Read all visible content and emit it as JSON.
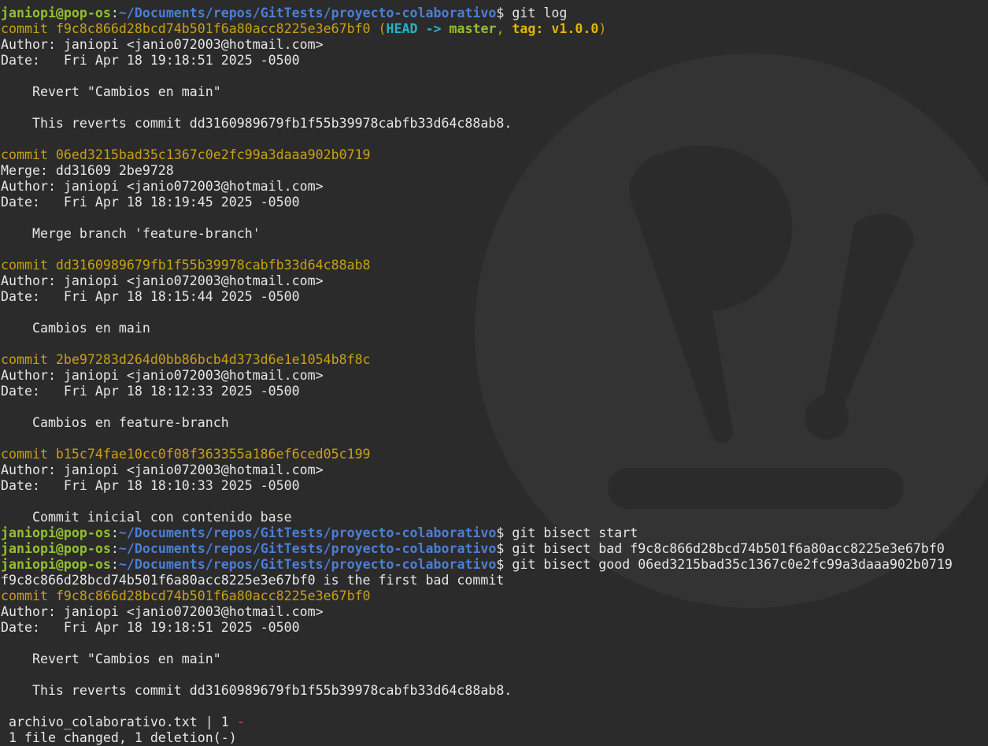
{
  "prompt": {
    "user": "janiopi@pop-os",
    "sep": ":",
    "path": "~/Documents/repos/GitTests/proyecto-colaborativo",
    "symbol": "$ "
  },
  "lines": [
    {
      "kind": "cut"
    },
    {
      "kind": "prompt",
      "cmd": "git log"
    },
    {
      "kind": "commit_ref",
      "prefix": "commit f9c8c866d28bcd74b501f6a80acc8225e3e67bf0 ",
      "open": "(",
      "head": "HEAD -> ",
      "branch": "master",
      "comma": ", ",
      "tag": "tag: v1.0.0",
      "close": ")"
    },
    {
      "kind": "text",
      "text": "Author: janiopi <janio072003@hotmail.com>"
    },
    {
      "kind": "text",
      "text": "Date:   Fri Apr 18 19:18:51 2025 -0500"
    },
    {
      "kind": "text",
      "text": ""
    },
    {
      "kind": "text",
      "text": "    Revert \"Cambios en main\""
    },
    {
      "kind": "text",
      "text": ""
    },
    {
      "kind": "text",
      "text": "    This reverts commit dd3160989679fb1f55b39978cabfb33d64c88ab8."
    },
    {
      "kind": "text",
      "text": ""
    },
    {
      "kind": "commit",
      "text": "commit 06ed3215bad35c1367c0e2fc99a3daaa902b0719"
    },
    {
      "kind": "text",
      "text": "Merge: dd31609 2be9728"
    },
    {
      "kind": "text",
      "text": "Author: janiopi <janio072003@hotmail.com>"
    },
    {
      "kind": "text",
      "text": "Date:   Fri Apr 18 18:19:45 2025 -0500"
    },
    {
      "kind": "text",
      "text": ""
    },
    {
      "kind": "text",
      "text": "    Merge branch 'feature-branch'"
    },
    {
      "kind": "text",
      "text": ""
    },
    {
      "kind": "commit",
      "text": "commit dd3160989679fb1f55b39978cabfb33d64c88ab8"
    },
    {
      "kind": "text",
      "text": "Author: janiopi <janio072003@hotmail.com>"
    },
    {
      "kind": "text",
      "text": "Date:   Fri Apr 18 18:15:44 2025 -0500"
    },
    {
      "kind": "text",
      "text": ""
    },
    {
      "kind": "text",
      "text": "    Cambios en main"
    },
    {
      "kind": "text",
      "text": ""
    },
    {
      "kind": "commit",
      "text": "commit 2be97283d264d0bb86bcb4d373d6e1e1054b8f8c"
    },
    {
      "kind": "text",
      "text": "Author: janiopi <janio072003@hotmail.com>"
    },
    {
      "kind": "text",
      "text": "Date:   Fri Apr 18 18:12:33 2025 -0500"
    },
    {
      "kind": "text",
      "text": ""
    },
    {
      "kind": "text",
      "text": "    Cambios en feature-branch"
    },
    {
      "kind": "text",
      "text": ""
    },
    {
      "kind": "commit",
      "text": "commit b15c74fae10cc0f08f363355a186ef6ced05c199"
    },
    {
      "kind": "text",
      "text": "Author: janiopi <janio072003@hotmail.com>"
    },
    {
      "kind": "text",
      "text": "Date:   Fri Apr 18 18:10:33 2025 -0500"
    },
    {
      "kind": "text",
      "text": ""
    },
    {
      "kind": "text",
      "text": "    Commit inicial con contenido base"
    },
    {
      "kind": "prompt",
      "cmd": "git bisect start"
    },
    {
      "kind": "prompt",
      "cmd": "git bisect bad f9c8c866d28bcd74b501f6a80acc8225e3e67bf0"
    },
    {
      "kind": "prompt",
      "cmd": "git bisect good 06ed3215bad35c1367c0e2fc99a3daaa902b0719"
    },
    {
      "kind": "text",
      "text": "f9c8c866d28bcd74b501f6a80acc8225e3e67bf0 is the first bad commit"
    },
    {
      "kind": "commit",
      "text": "commit f9c8c866d28bcd74b501f6a80acc8225e3e67bf0"
    },
    {
      "kind": "text",
      "text": "Author: janiopi <janio072003@hotmail.com>"
    },
    {
      "kind": "text",
      "text": "Date:   Fri Apr 18 19:18:51 2025 -0500"
    },
    {
      "kind": "text",
      "text": ""
    },
    {
      "kind": "text",
      "text": "    Revert \"Cambios en main\""
    },
    {
      "kind": "text",
      "text": ""
    },
    {
      "kind": "text",
      "text": "    This reverts commit dd3160989679fb1f55b39978cabfb33d64c88ab8."
    },
    {
      "kind": "text",
      "text": ""
    },
    {
      "kind": "stat",
      "text": " archivo_colaborativo.txt | 1 ",
      "minus": "-"
    },
    {
      "kind": "text",
      "text": " 1 file changed, 1 deletion(-)"
    }
  ],
  "colors": {
    "background": "#2b2b2b",
    "text": "#e6e6e6",
    "prompt_user": "#94bf30",
    "prompt_path": "#4a7fd6",
    "commit_hash": "#c8a017",
    "head_ref": "#27b1c6",
    "tag_ref": "#e0b400",
    "deletion": "#e04a3f"
  },
  "background_logo": "pop-os-logo"
}
